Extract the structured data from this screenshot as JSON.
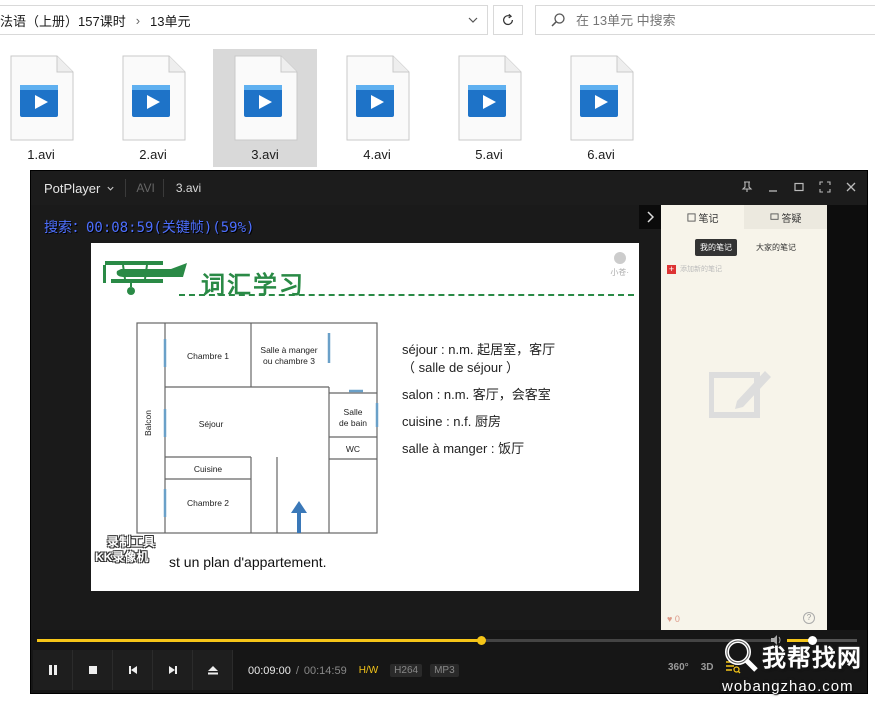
{
  "explorer": {
    "breadcrumb": [
      "法语（上册）157课时",
      "13单元"
    ],
    "breadcrumb_sep": "›",
    "search_placeholder": "在 13单元 中搜索"
  },
  "files": [
    {
      "name": "1.avi",
      "selected": false
    },
    {
      "name": "2.avi",
      "selected": false
    },
    {
      "name": "3.avi",
      "selected": true
    },
    {
      "name": "4.avi",
      "selected": false
    },
    {
      "name": "5.avi",
      "selected": false
    },
    {
      "name": "6.avi",
      "selected": false
    }
  ],
  "player": {
    "app_name": "PotPlayer",
    "format": "AVI",
    "file": "3.avi",
    "osd": "搜索：00:08:59(关键帧)(59%)",
    "slide": {
      "title": "词汇学习",
      "logo": "小苍·",
      "rooms": {
        "chambre1": "Chambre 1",
        "salle_a_manger": "Salle à manger",
        "ou_chambre3": "ou chambre 3",
        "balcon": "Balcon",
        "sejour": "Séjour",
        "salle_de": "Salle",
        "de_bain": "de bain",
        "wc": "WC",
        "cuisine": "Cuisine",
        "chambre2": "Chambre 2"
      },
      "vocab": [
        "séjour : n.m. 起居室，客厅",
        "（ salle de séjour ）",
        "salon : n.m. 客厅，会客室",
        "cuisine : n.f. 厨房",
        "salle à manger : 饭厅"
      ],
      "caption": "st un plan d'appartement.",
      "rec_line1": "录制工具",
      "rec_line2": "KK录像机"
    },
    "notes": {
      "tab_notes": "笔记",
      "tab_qa": "答疑",
      "my_notes": "我的笔记",
      "everyone_notes": "大家的笔记",
      "add_note": "添加新的笔记",
      "likes": "0",
      "help": "?"
    },
    "controls": {
      "current_time": "00:09:00",
      "time_sep": "/",
      "total_time": "00:14:59",
      "progress": 0.6,
      "volume": 0.35,
      "tag_hw": "H/W",
      "tag_codec": "H264",
      "tag_audio": "MP3",
      "btn_360": "360°",
      "btn_3d": "3D"
    }
  },
  "site": {
    "cn": "我帮找网",
    "url": "wobangzhao.com"
  },
  "colors": {
    "accent": "#f5c518",
    "osd": "#4d6fff",
    "slide_green": "#2a8a46",
    "selected_tile": "#d9d9d9"
  }
}
